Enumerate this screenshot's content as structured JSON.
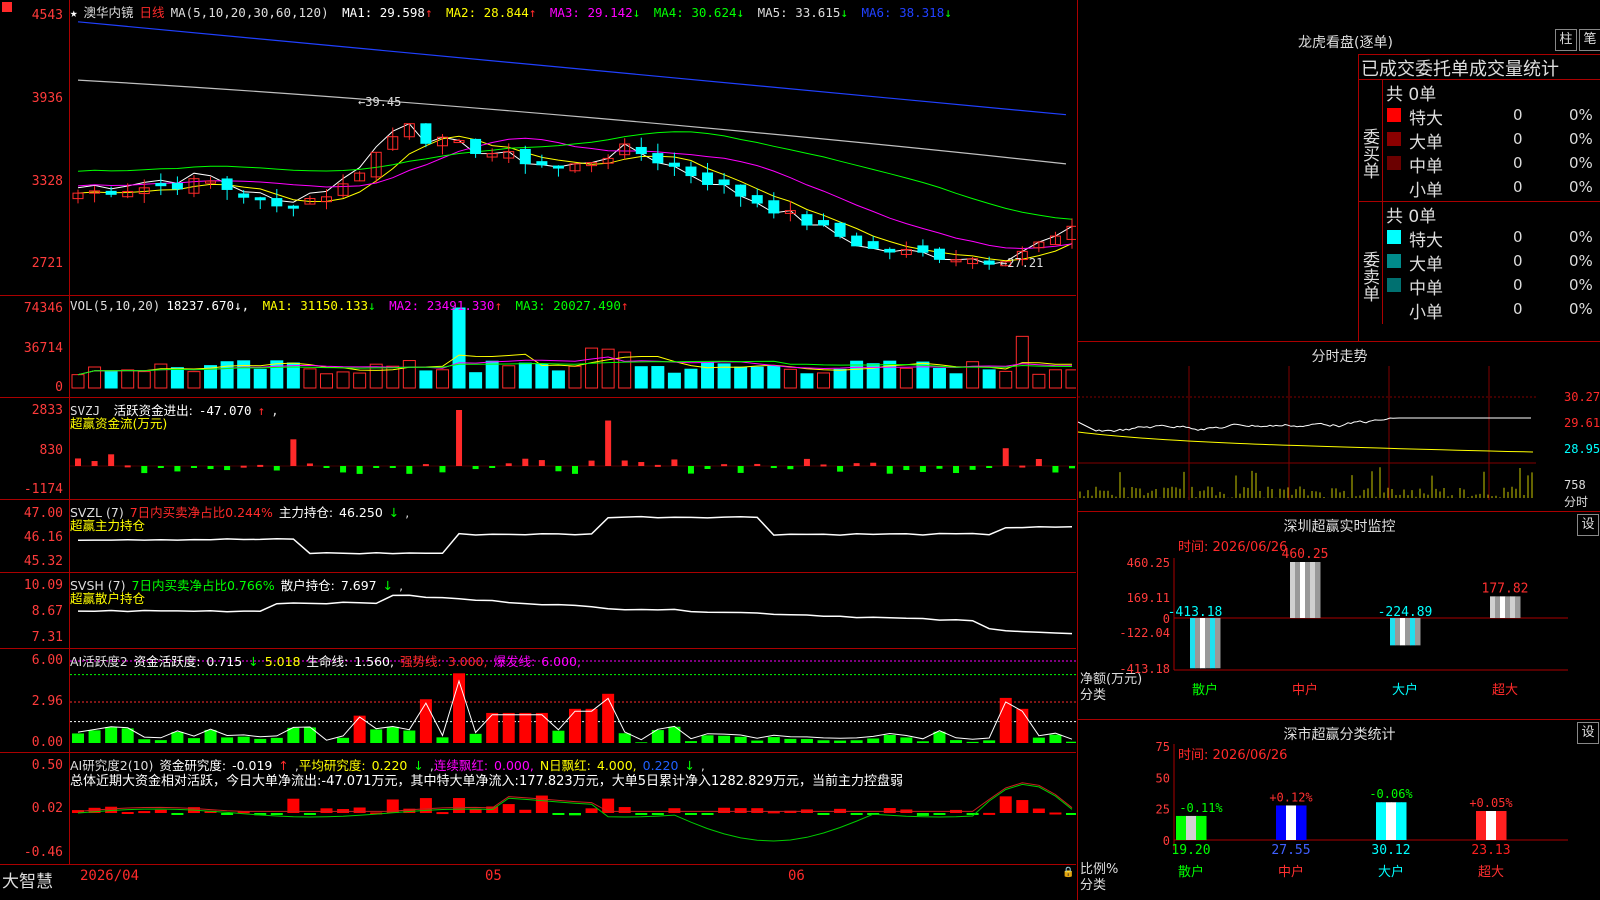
{
  "colors": {
    "up": "#ff2a2a",
    "down": "#00ffff",
    "ma1": "#ffffff",
    "ma2": "#ffff00",
    "ma3": "#ff00ff",
    "ma4": "#00ff00",
    "ma5": "#c0c0c0",
    "ma6": "#2040ff",
    "grid": "#a00000"
  },
  "main": {
    "stock_name": "澳华内镜",
    "period": "日线",
    "ma_params": "MA(5,10,20,30,60,120)",
    "ma": [
      {
        "label": "MA1:",
        "value": "29.598",
        "arrow": "↑"
      },
      {
        "label": "MA2:",
        "value": "28.844",
        "arrow": "↑"
      },
      {
        "label": "MA3:",
        "value": "29.142",
        "arrow": "↓"
      },
      {
        "label": "MA4:",
        "value": "30.624",
        "arrow": "↓"
      },
      {
        "label": "MA5:",
        "value": "33.615",
        "arrow": "↓"
      },
      {
        "label": "MA6:",
        "value": "38.318",
        "arrow": "↓"
      }
    ],
    "y_labels": [
      "4543",
      "3936",
      "3328",
      "2721"
    ],
    "high_mark": "39.45",
    "low_mark": "←27.21"
  },
  "vol": {
    "header": "VOL(5,10,20)",
    "value": "18237.670↓,",
    "ma": [
      {
        "label": "MA1:",
        "value": "31150.133",
        "arrow": "↓"
      },
      {
        "label": "MA2:",
        "value": "23491.330",
        "arrow": "↑"
      },
      {
        "label": "MA3:",
        "value": "20027.490",
        "arrow": "↑"
      }
    ],
    "y_labels": [
      "74346",
      "36714",
      "0"
    ]
  },
  "svzj": {
    "name": "SVZJ",
    "label": "活跃资金进出:",
    "value": "-47.070",
    "arrow": "↑",
    "sub": "超赢资金流(万元)",
    "y_labels": [
      "2833",
      "830",
      "-1174"
    ]
  },
  "svzl": {
    "name": "SVZL (7)",
    "label1": "7日内买卖净占比0.244%",
    "label2": "主力持仓:",
    "value": "46.250",
    "arrow": "↓",
    "sub": "超赢主力持仓",
    "y_labels": [
      "47.00",
      "46.16",
      "45.32"
    ]
  },
  "svsh": {
    "name": "SVSH (7)",
    "label1": "7日内买卖净占比0.766%",
    "label2": "散户持仓:",
    "value": "7.697",
    "arrow": "↓",
    "sub": "超赢散户持仓",
    "y_labels": [
      "10.09",
      "8.67",
      "7.31"
    ]
  },
  "ai1": {
    "name": "AI活跃度2",
    "l1": "资金活跃度:",
    "v1": "0.715",
    "a1": "↓",
    "v2": "5.018",
    "l3": "生命线:",
    "v3": "1.560,",
    "l4": "强势线:",
    "v4": "3.000,",
    "l5": "爆发线:",
    "v5": "6.000,",
    "y_labels": [
      "6.00",
      "2.96",
      "0.00"
    ]
  },
  "ai2": {
    "name": "AI研究度2(10)",
    "l1": "资金研究度:",
    "v1": "-0.019",
    "a1": "↑",
    "l2": "平均研究度:",
    "v2": "0.220",
    "a2": "↓",
    "l3": "连续飘红:",
    "v3": "0.000,",
    "l4": "N日飘红:",
    "v4": "4.000,",
    "v5": "0.220",
    "a5": "↓",
    "summary": "总体近期大资金相对活跃，今日大单净流出:-47.071万元，其中特大单净流入:177.823万元，大单5日累计净入1282.829万元，当前主力控盘弱",
    "y_labels": [
      "0.50",
      "0.02",
      "-0.46"
    ]
  },
  "xaxis": {
    "brand": "大智慧",
    "labels": [
      "2026/04",
      "05",
      "06"
    ]
  },
  "dragon": {
    "title": "龙虎看盘(逐单)",
    "btn1": "柱",
    "btn2": "笔",
    "subtitle": "已成交委托单成交量统计",
    "buy_label": "委买单",
    "sell_label": "委卖单",
    "buy_total": "共 0单",
    "sell_total": "共 0单",
    "buy_rows": [
      {
        "name": "特大",
        "count": "0",
        "pct": "0%"
      },
      {
        "name": "大单",
        "count": "0",
        "pct": "0%"
      },
      {
        "name": "中单",
        "count": "0",
        "pct": "0%"
      },
      {
        "name": "小单",
        "count": "0",
        "pct": "0%"
      }
    ],
    "sell_rows": [
      {
        "name": "特大",
        "count": "0",
        "pct": "0%"
      },
      {
        "name": "大单",
        "count": "0",
        "pct": "0%"
      },
      {
        "name": "中单",
        "count": "0",
        "pct": "0%"
      },
      {
        "name": "小单",
        "count": "0",
        "pct": "0%"
      }
    ]
  },
  "intraday": {
    "title": "分时走势",
    "y_labels": [
      "30.27",
      "29.61",
      "28.95"
    ],
    "vol_label": "758",
    "unit": "分时"
  },
  "monitor": {
    "title": "深圳超赢实时监控",
    "btn": "设",
    "time": "时间: 2026/06/26",
    "y_labels": [
      "460.25",
      "169.11",
      "0",
      "-122.04",
      "-413.18"
    ],
    "bars": [
      {
        "cat": "散户",
        "value": -413.18,
        "label": "-413.18"
      },
      {
        "cat": "中户",
        "value": 460.25,
        "label": "460.25"
      },
      {
        "cat": "大户",
        "value": -224.89,
        "label": "-224.89"
      },
      {
        "cat": "超大",
        "value": 177.82,
        "label": "177.82"
      }
    ],
    "axis_label1": "净额(万元)",
    "axis_label2": "分类"
  },
  "stats": {
    "title": "深市超赢分类统计",
    "btn": "设",
    "time": "时间: 2026/06/26",
    "y_labels": [
      "75",
      "50",
      "25",
      "0"
    ],
    "bars": [
      {
        "cat": "散户",
        "value": 19.2,
        "label": "19.20",
        "delta": "-0.11%"
      },
      {
        "cat": "中户",
        "value": 27.55,
        "label": "27.55",
        "delta": "+0.12%"
      },
      {
        "cat": "大户",
        "value": 30.12,
        "label": "30.12",
        "delta": "-0.06%"
      },
      {
        "cat": "超大",
        "value": 23.13,
        "label": "23.13",
        "delta": "+0.05%"
      }
    ],
    "axis_label1": "比例%",
    "axis_label2": "分类"
  }
}
